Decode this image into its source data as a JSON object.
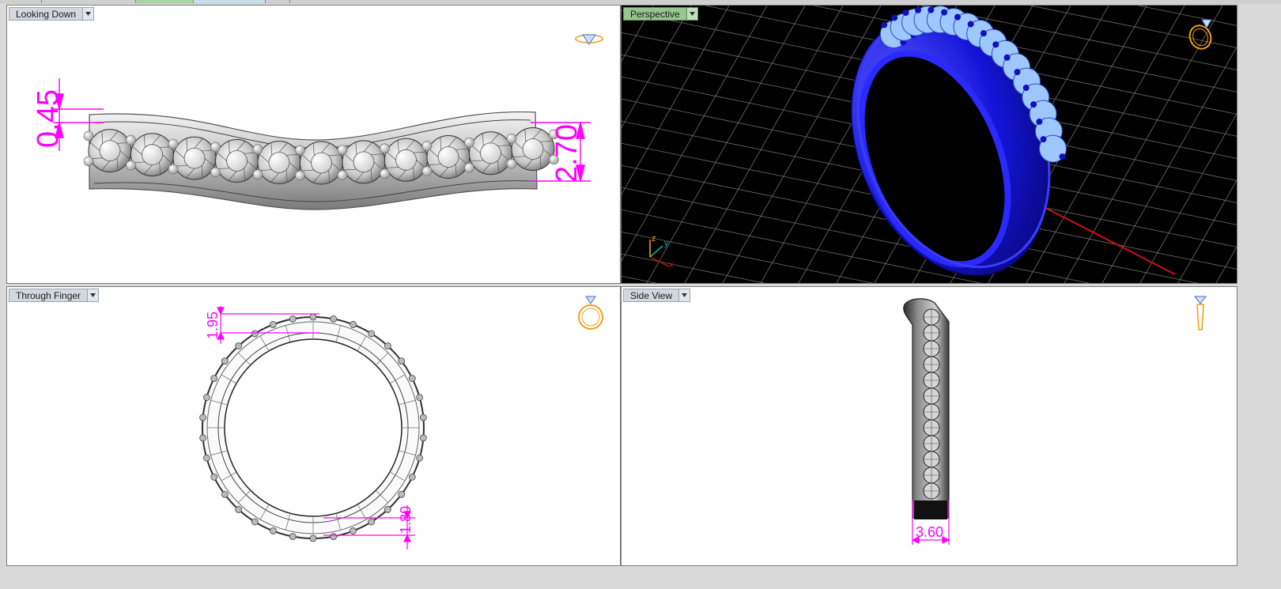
{
  "viewports": [
    {
      "id": "top",
      "label": "Looking Down",
      "active": false
    },
    {
      "id": "persp",
      "label": "Perspective",
      "active": true
    },
    {
      "id": "front",
      "label": "Through Finger",
      "active": false
    },
    {
      "id": "side",
      "label": "Side View",
      "active": false
    }
  ],
  "dimensions": {
    "top_small": "0.45",
    "top_large": "2.70",
    "front_top": "1.95",
    "front_bottom": "1.80",
    "side_width": "3.60"
  },
  "axes": {
    "z": "z",
    "y": "y",
    "x": "x"
  },
  "colors": {
    "dimension": "#ff00ff",
    "ring_blue": "#1a1ae0",
    "gem_blue": "#9ec7ff",
    "nav_icon": "#f0a020",
    "grid": "#6e6e6e",
    "axis_x": "#cc1111",
    "axis_y": "#11aaaa"
  }
}
